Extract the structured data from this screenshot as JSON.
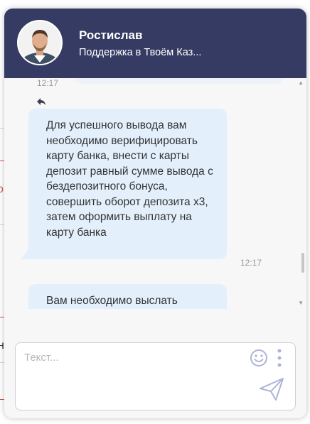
{
  "agent": {
    "name": "Ростислав",
    "subtitle": "Поддержка в Твоём Каз..."
  },
  "messages": [
    {
      "text": "Для успешного вывода вам необходимо верифицировать карту банка, внести с карты депозит равный сумме вывода с бездепозитного бонуса, совершить оборот депозита x3, затем оформить выплату на карту банка",
      "time": "12:17"
    },
    {
      "text": "Вам необходимо выслать"
    }
  ],
  "previous_message_time": "12:17",
  "composer": {
    "placeholder": "Текст..."
  },
  "background_fragments": {
    "left_a": "о",
    "left_b": "н"
  },
  "colors": {
    "header_bg": "#363b63",
    "bubble_bg": "#e3f0fc",
    "panel_bg": "#f7f7f7",
    "icon": "#aeb4d6",
    "accent_red": "#d9534f"
  },
  "icons": [
    "reply-icon",
    "emoji-icon",
    "more-vert-icon",
    "send-icon"
  ]
}
